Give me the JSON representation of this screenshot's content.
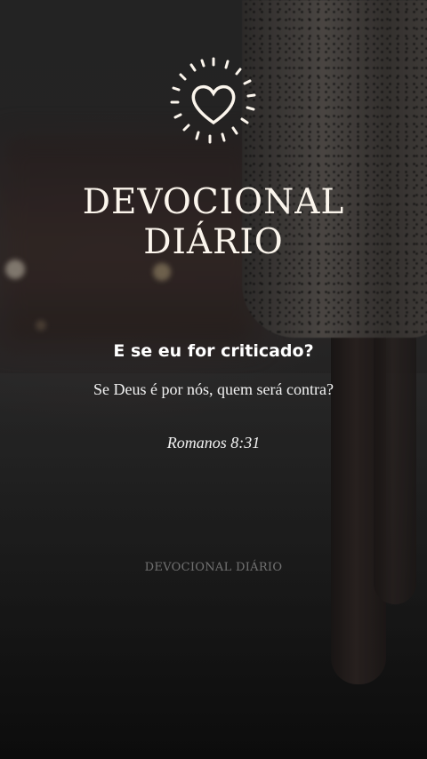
{
  "logo": {
    "icon": "heart-icon",
    "line1": "DEVOCIONAL",
    "line2": "DIÁRIO"
  },
  "question": "E se eu for criticado?",
  "verse": "Se Deus é por nós, quem será contra?",
  "reference": "Romanos 8:31",
  "watermark": "DEVOCIONAL DIÁRIO",
  "colors": {
    "text": "#ffffff",
    "logo": "#fbf5ec",
    "background": "#2a2a2a"
  }
}
